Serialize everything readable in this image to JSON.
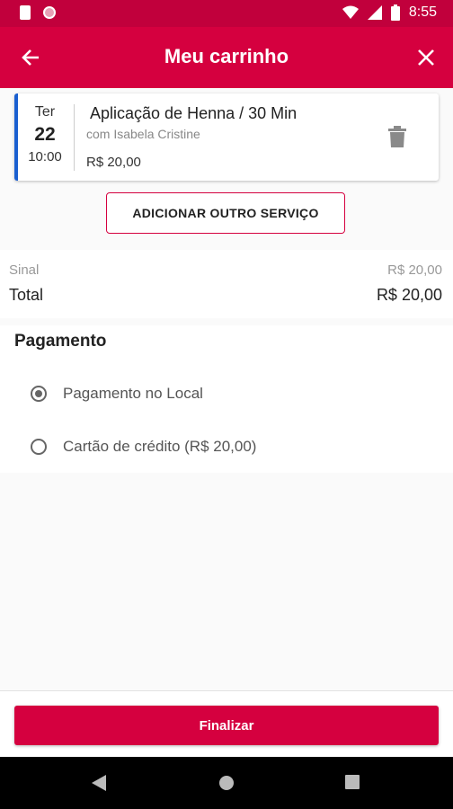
{
  "status_bar": {
    "time": "8:55"
  },
  "app_bar": {
    "title": "Meu carrinho"
  },
  "cart_item": {
    "weekday": "Ter",
    "day": "22",
    "time": "10:00",
    "service": "Aplicação de Henna / 30 Min",
    "professional": "com Isabela Cristine",
    "price": "R$ 20,00"
  },
  "add_service_label": "ADICIONAR OUTRO SERVIÇO",
  "summary": {
    "deposit_label": "Sinal",
    "deposit_value": "R$ 20,00",
    "total_label": "Total",
    "total_value": "R$ 20,00"
  },
  "payment": {
    "title": "Pagamento",
    "options": [
      {
        "label": "Pagamento no Local",
        "selected": true
      },
      {
        "label": "Cartão de crédito (R$ 20,00)",
        "selected": false
      }
    ]
  },
  "finish_label": "Finalizar",
  "colors": {
    "primary": "#d5003f",
    "status_bar": "#c1003c",
    "accent_stripe": "#1a5fd0"
  }
}
